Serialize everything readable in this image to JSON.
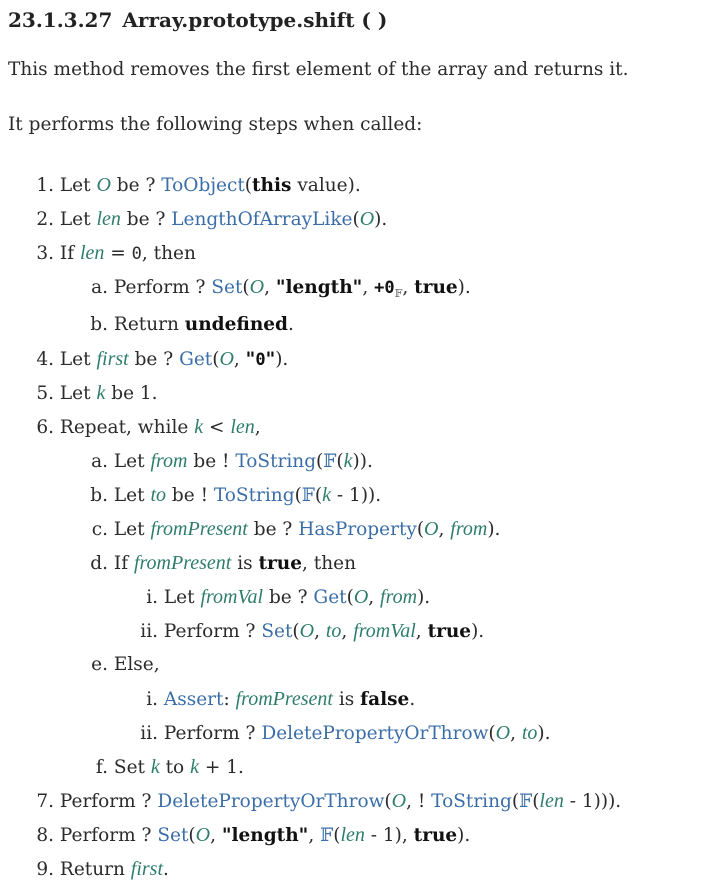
{
  "heading": {
    "section_number": "23.1.3.27",
    "title": "Array.prototype.shift ( )"
  },
  "paragraphs": [
    "This method removes the first element of the array and returns it.",
    "It performs the following steps when called:"
  ],
  "colors": {
    "link": "#3b6ea8",
    "variable": "#2e7d6b",
    "text": "#2b2b2b"
  },
  "steps": [
    {
      "num": "1.",
      "level": 1,
      "parts": [
        [
          "t",
          "Let "
        ],
        [
          "v",
          "O"
        ],
        [
          "t",
          " be ? "
        ],
        [
          "l",
          "ToObject"
        ],
        [
          "t",
          "("
        ],
        [
          "b",
          "this"
        ],
        [
          "t",
          " value)."
        ]
      ]
    },
    {
      "num": "2.",
      "level": 1,
      "parts": [
        [
          "t",
          "Let "
        ],
        [
          "v",
          "len"
        ],
        [
          "t",
          " be ? "
        ],
        [
          "l",
          "LengthOfArrayLike"
        ],
        [
          "t",
          "("
        ],
        [
          "v",
          "O"
        ],
        [
          "t",
          ")."
        ]
      ]
    },
    {
      "num": "3.",
      "level": 1,
      "parts": [
        [
          "t",
          "If "
        ],
        [
          "v",
          "len"
        ],
        [
          "t",
          " = "
        ],
        [
          "m",
          "0"
        ],
        [
          "t",
          ", then"
        ]
      ]
    },
    {
      "num": "a.",
      "level": 2,
      "gap": true,
      "parts": [
        [
          "t",
          "Perform ? "
        ],
        [
          "l",
          "Set"
        ],
        [
          "t",
          "("
        ],
        [
          "v",
          "O"
        ],
        [
          "t",
          ", "
        ],
        [
          "b",
          "\"length\""
        ],
        [
          "t",
          ", "
        ],
        [
          "mb",
          "+0"
        ],
        [
          "sub",
          "𝔽"
        ],
        [
          "t",
          ", "
        ],
        [
          "b",
          "true"
        ],
        [
          "t",
          ")."
        ]
      ]
    },
    {
      "num": "b.",
      "level": 2,
      "parts": [
        [
          "t",
          "Return "
        ],
        [
          "b",
          "undefined"
        ],
        [
          "t",
          "."
        ]
      ]
    },
    {
      "num": "4.",
      "level": 1,
      "parts": [
        [
          "t",
          "Let "
        ],
        [
          "v",
          "first"
        ],
        [
          "t",
          " be ? "
        ],
        [
          "l",
          "Get"
        ],
        [
          "t",
          "("
        ],
        [
          "v",
          "O"
        ],
        [
          "t",
          ", "
        ],
        [
          "b",
          "\""
        ],
        [
          "mb",
          "0"
        ],
        [
          "b",
          "\""
        ],
        [
          "t",
          ")."
        ]
      ]
    },
    {
      "num": "5.",
      "level": 1,
      "parts": [
        [
          "t",
          "Let "
        ],
        [
          "v",
          "k"
        ],
        [
          "t",
          " be 1."
        ]
      ]
    },
    {
      "num": "6.",
      "level": 1,
      "parts": [
        [
          "t",
          "Repeat, while "
        ],
        [
          "v",
          "k"
        ],
        [
          "t",
          " < "
        ],
        [
          "v",
          "len"
        ],
        [
          "t",
          ","
        ]
      ]
    },
    {
      "num": "a.",
      "level": 2,
      "parts": [
        [
          "t",
          "Let "
        ],
        [
          "v",
          "from"
        ],
        [
          "t",
          " be ! "
        ],
        [
          "l",
          "ToString"
        ],
        [
          "t",
          "("
        ],
        [
          "l",
          "𝔽"
        ],
        [
          "t",
          "("
        ],
        [
          "v",
          "k"
        ],
        [
          "t",
          "))."
        ]
      ]
    },
    {
      "num": "b.",
      "level": 2,
      "parts": [
        [
          "t",
          "Let "
        ],
        [
          "v",
          "to"
        ],
        [
          "t",
          " be ! "
        ],
        [
          "l",
          "ToString"
        ],
        [
          "t",
          "("
        ],
        [
          "l",
          "𝔽"
        ],
        [
          "t",
          "("
        ],
        [
          "v",
          "k"
        ],
        [
          "t",
          " - 1))."
        ]
      ]
    },
    {
      "num": "c.",
      "level": 2,
      "parts": [
        [
          "t",
          "Let "
        ],
        [
          "v",
          "fromPresent"
        ],
        [
          "t",
          " be ? "
        ],
        [
          "l",
          "HasProperty"
        ],
        [
          "t",
          "("
        ],
        [
          "v",
          "O"
        ],
        [
          "t",
          ", "
        ],
        [
          "v",
          "from"
        ],
        [
          "t",
          ")."
        ]
      ]
    },
    {
      "num": "d.",
      "level": 2,
      "parts": [
        [
          "t",
          "If "
        ],
        [
          "v",
          "fromPresent"
        ],
        [
          "t",
          " is "
        ],
        [
          "b",
          "true"
        ],
        [
          "t",
          ", then"
        ]
      ]
    },
    {
      "num": "i.",
      "level": 3,
      "parts": [
        [
          "t",
          "Let "
        ],
        [
          "v",
          "fromVal"
        ],
        [
          "t",
          " be ? "
        ],
        [
          "l",
          "Get"
        ],
        [
          "t",
          "("
        ],
        [
          "v",
          "O"
        ],
        [
          "t",
          ", "
        ],
        [
          "v",
          "from"
        ],
        [
          "t",
          ")."
        ]
      ]
    },
    {
      "num": "ii.",
      "level": 3,
      "parts": [
        [
          "t",
          "Perform ? "
        ],
        [
          "l",
          "Set"
        ],
        [
          "t",
          "("
        ],
        [
          "v",
          "O"
        ],
        [
          "t",
          ", "
        ],
        [
          "v",
          "to"
        ],
        [
          "t",
          ", "
        ],
        [
          "v",
          "fromVal"
        ],
        [
          "t",
          ", "
        ],
        [
          "b",
          "true"
        ],
        [
          "t",
          ")."
        ]
      ]
    },
    {
      "num": "e.",
      "level": 2,
      "parts": [
        [
          "t",
          "Else,"
        ]
      ]
    },
    {
      "num": "i.",
      "level": 3,
      "parts": [
        [
          "l",
          "Assert"
        ],
        [
          "t",
          ": "
        ],
        [
          "v",
          "fromPresent"
        ],
        [
          "t",
          " is "
        ],
        [
          "b",
          "false"
        ],
        [
          "t",
          "."
        ]
      ]
    },
    {
      "num": "ii.",
      "level": 3,
      "parts": [
        [
          "t",
          "Perform ? "
        ],
        [
          "l",
          "DeletePropertyOrThrow"
        ],
        [
          "t",
          "("
        ],
        [
          "v",
          "O"
        ],
        [
          "t",
          ", "
        ],
        [
          "v",
          "to"
        ],
        [
          "t",
          ")."
        ]
      ]
    },
    {
      "num": "f.",
      "level": 2,
      "parts": [
        [
          "t",
          "Set "
        ],
        [
          "v",
          "k"
        ],
        [
          "t",
          " to "
        ],
        [
          "v",
          "k"
        ],
        [
          "t",
          " + 1."
        ]
      ]
    },
    {
      "num": "7.",
      "level": 1,
      "parts": [
        [
          "t",
          "Perform ? "
        ],
        [
          "l",
          "DeletePropertyOrThrow"
        ],
        [
          "t",
          "("
        ],
        [
          "v",
          "O"
        ],
        [
          "t",
          ", ! "
        ],
        [
          "l",
          "ToString"
        ],
        [
          "t",
          "("
        ],
        [
          "l",
          "𝔽"
        ],
        [
          "t",
          "("
        ],
        [
          "v",
          "len"
        ],
        [
          "t",
          " - 1)))."
        ]
      ]
    },
    {
      "num": "8.",
      "level": 1,
      "parts": [
        [
          "t",
          "Perform ? "
        ],
        [
          "l",
          "Set"
        ],
        [
          "t",
          "("
        ],
        [
          "v",
          "O"
        ],
        [
          "t",
          ", "
        ],
        [
          "b",
          "\"length\""
        ],
        [
          "t",
          ", "
        ],
        [
          "l",
          "𝔽"
        ],
        [
          "t",
          "("
        ],
        [
          "v",
          "len"
        ],
        [
          "t",
          " - 1), "
        ],
        [
          "b",
          "true"
        ],
        [
          "t",
          ")."
        ]
      ]
    },
    {
      "num": "9.",
      "level": 1,
      "parts": [
        [
          "t",
          "Return "
        ],
        [
          "v",
          "first"
        ],
        [
          "t",
          "."
        ]
      ]
    }
  ]
}
